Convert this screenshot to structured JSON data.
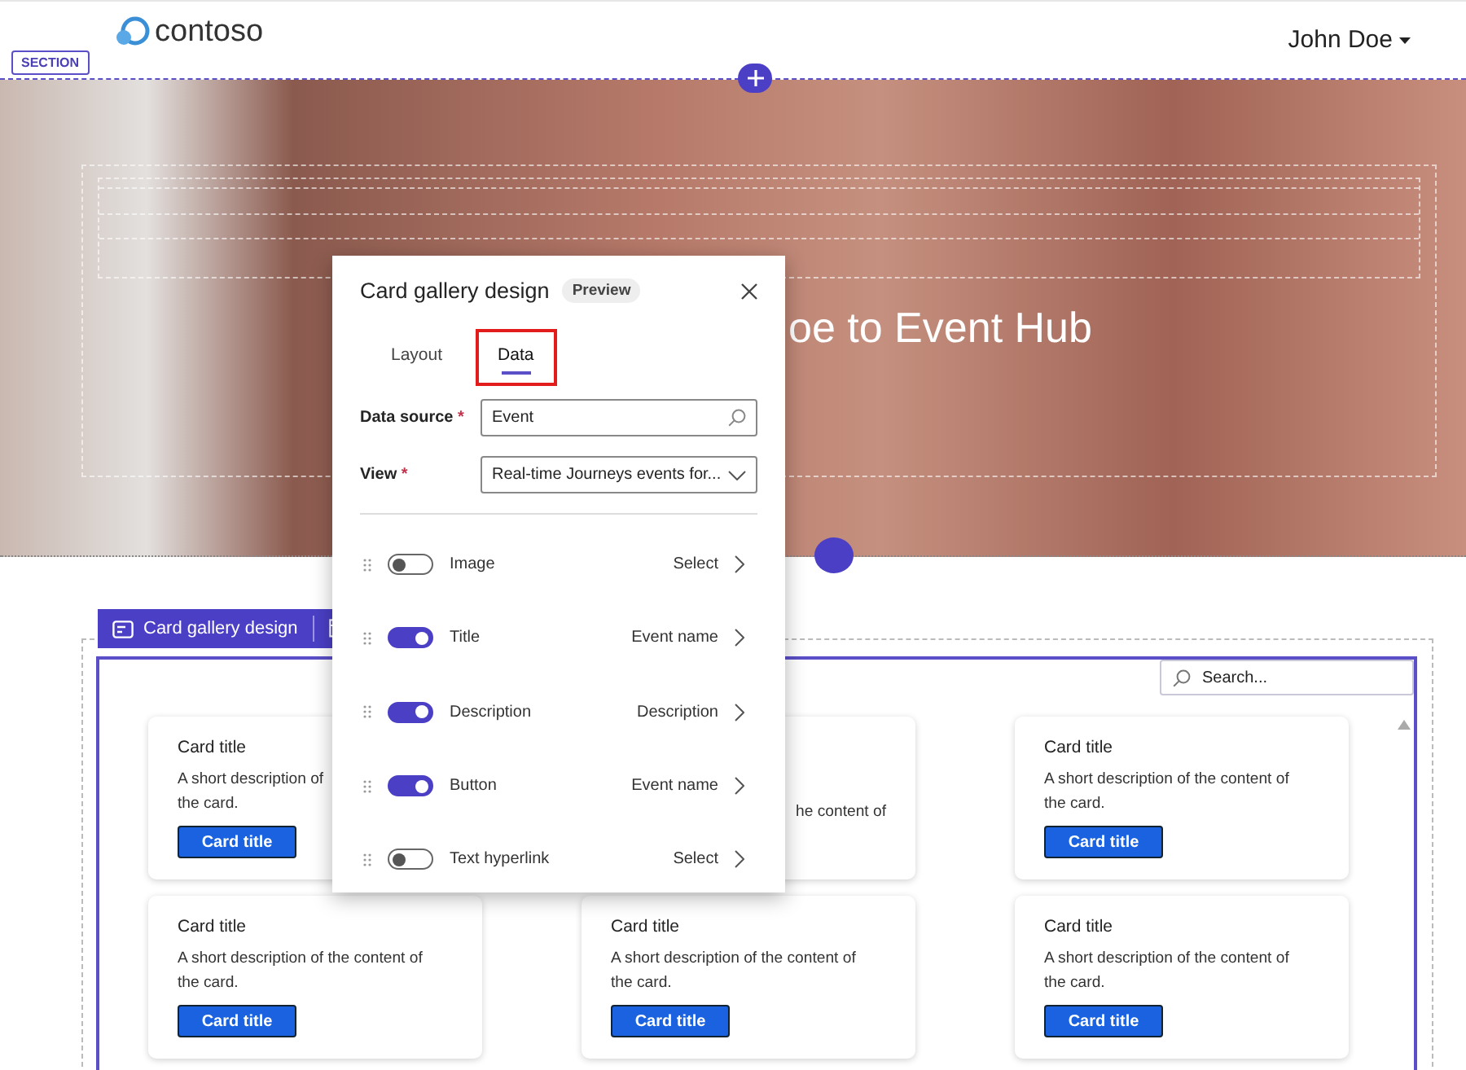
{
  "header": {
    "logo": "contoso",
    "user": "John Doe"
  },
  "section_label": "SECTION",
  "hero": {
    "title": "oe to Event Hub"
  },
  "toolbar": {
    "label": "Card gallery design"
  },
  "search": {
    "placeholder": "Search..."
  },
  "cards": [
    {
      "kind": "full",
      "title": "Card title",
      "description_lines": [
        "A short description of",
        "the card."
      ],
      "button": "Card title"
    },
    {
      "kind": "covered",
      "description_lines": [
        "he content of"
      ]
    },
    {
      "kind": "full",
      "title": "Card title",
      "description_lines": [
        "A short description of the content of",
        "the card."
      ],
      "button": "Card title"
    },
    {
      "kind": "full",
      "title": "Card title",
      "description_lines": [
        "A short description of the content of",
        "the card."
      ],
      "button": "Card title"
    },
    {
      "kind": "full",
      "title": "Card title",
      "description_lines": [
        "A short description of the content of",
        "the card."
      ],
      "button": "Card title"
    },
    {
      "kind": "full",
      "title": "Card title",
      "description_lines": [
        "A short description of the content of",
        "the card."
      ],
      "button": "Card title"
    }
  ],
  "dialog": {
    "title": "Card gallery design",
    "badge": "Preview",
    "tabs": [
      {
        "label": "Layout",
        "selected": false,
        "highlighted": false
      },
      {
        "label": "Data",
        "selected": true,
        "highlighted": true
      }
    ],
    "fields": [
      {
        "label": "Data source",
        "required_mark": "*",
        "kind": "search",
        "value": "Event"
      },
      {
        "label": "View",
        "required_mark": "*",
        "kind": "select",
        "value": "Real-time Journeys events for..."
      }
    ],
    "properties": [
      {
        "name": "Image",
        "on": false,
        "value": "Select"
      },
      {
        "name": "Title",
        "on": true,
        "value": "Event name"
      },
      {
        "name": "Description",
        "on": true,
        "value": "Description"
      },
      {
        "name": "Button",
        "on": true,
        "value": "Event name"
      },
      {
        "name": "Text hyperlink",
        "on": false,
        "value": "Select"
      }
    ]
  }
}
